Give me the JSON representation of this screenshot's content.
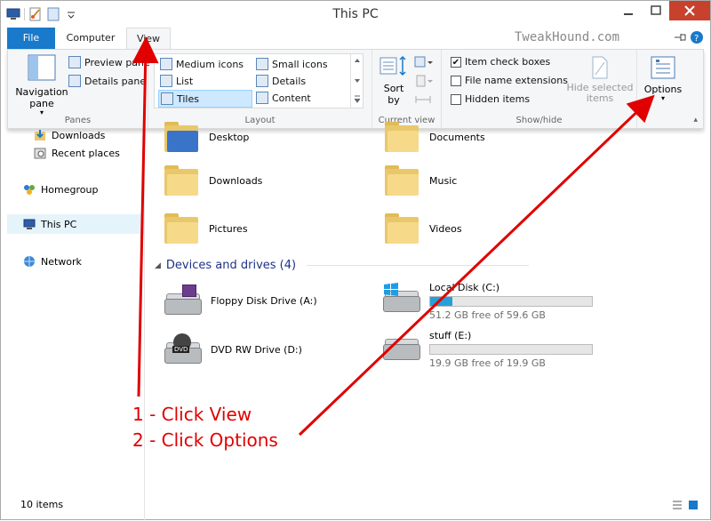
{
  "window": {
    "title": "This PC",
    "watermark": "TweakHound.com"
  },
  "tabs": [
    {
      "label": "File"
    },
    {
      "label": "Computer"
    },
    {
      "label": "View"
    }
  ],
  "ribbon": {
    "panes": {
      "group_label": "Panes",
      "navigation_pane": "Navigation pane",
      "preview_pane": "Preview pane",
      "details_pane": "Details pane"
    },
    "layout": {
      "group_label": "Layout",
      "items": [
        "Medium icons",
        "List",
        "Tiles",
        "Small icons",
        "Details",
        "Content"
      ],
      "selected": "Tiles"
    },
    "current_view": {
      "group_label": "Current view",
      "sort_by": "Sort by"
    },
    "show_hide": {
      "group_label": "Show/hide",
      "item_check_boxes": "Item check boxes",
      "item_check_boxes_checked": true,
      "file_name_extensions": "File name extensions",
      "hidden_items": "Hidden items",
      "hide_selected_items": "Hide selected items"
    },
    "options": {
      "label": "Options"
    }
  },
  "nav": {
    "items": [
      {
        "label": "Downloads",
        "icon": "downloads-icon"
      },
      {
        "label": "Recent places",
        "icon": "recent-places-icon"
      },
      {
        "label": "Homegroup",
        "icon": "homegroup-icon"
      },
      {
        "label": "This PC",
        "icon": "computer-icon"
      },
      {
        "label": "Network",
        "icon": "network-icon"
      }
    ]
  },
  "folders": [
    {
      "label": "Desktop"
    },
    {
      "label": "Documents"
    },
    {
      "label": "Downloads"
    },
    {
      "label": "Music"
    },
    {
      "label": "Pictures"
    },
    {
      "label": "Videos"
    }
  ],
  "devices": {
    "heading": "Devices and drives (4)",
    "drives": [
      {
        "label": "Floppy Disk Drive (A:)"
      },
      {
        "label": "Local Disk (C:)",
        "free": "51.2 GB free of 59.6 GB",
        "used_fraction": 0.14
      },
      {
        "label": "DVD RW Drive (D:)",
        "badge": "DVD"
      },
      {
        "label": "stuff (E:)",
        "free": "19.9 GB free of 19.9 GB",
        "used_fraction": 0.0
      }
    ]
  },
  "status": {
    "items": "10 items"
  },
  "annotations": {
    "step1": "1 - Click View",
    "step2": "2 - Click Options",
    "color": "#e00000"
  }
}
